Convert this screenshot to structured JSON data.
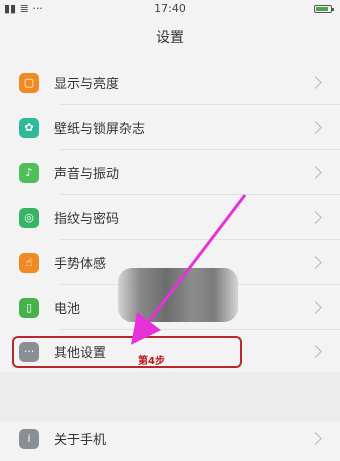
{
  "status_bar": {
    "left": "▮▮ ≣ ···",
    "time": "17:40"
  },
  "header": {
    "title": "设置"
  },
  "settings": [
    {
      "label": "显示与亮度",
      "icon": "display-icon",
      "color": "#f08a24",
      "glyph": "▢"
    },
    {
      "label": "壁纸与锁屏杂志",
      "icon": "wallpaper-icon",
      "color": "#2fb89a",
      "glyph": "✿"
    },
    {
      "label": "声音与振动",
      "icon": "sound-icon",
      "color": "#4fbf5a",
      "glyph": "♪"
    },
    {
      "label": "指纹与密码",
      "icon": "fingerprint-icon",
      "color": "#38b564",
      "glyph": "◎"
    },
    {
      "label": "手势体感",
      "icon": "gesture-icon",
      "color": "#f08a24",
      "glyph": "☝"
    },
    {
      "label": "电池",
      "icon": "battery-icon",
      "color": "#45b34a",
      "glyph": "▯"
    },
    {
      "label": "其他设置",
      "icon": "more-settings-icon",
      "color": "#8a8f96",
      "glyph": "···"
    },
    {
      "label": "关于手机",
      "icon": "about-phone-icon",
      "color": "#8a8f96",
      "glyph": "i"
    }
  ],
  "annotation": {
    "step_label": "第4步",
    "accent_color": "#e633d9",
    "box_color": "#b7282e"
  }
}
